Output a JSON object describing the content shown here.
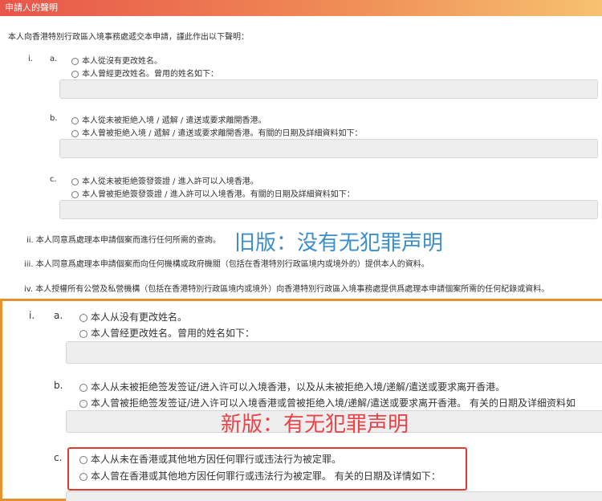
{
  "header": {
    "title": "申請人的聲明"
  },
  "old": {
    "intro": "本人向香港特別行政區入境事務處遞交本申請，謹此作出以下聲明：",
    "item_i": "i.",
    "a": {
      "label": "a.",
      "opt1": "本人從沒有更改姓名。",
      "opt2": "本人曾經更改姓名。曾用的姓名如下："
    },
    "b": {
      "label": "b.",
      "opt1": "本人從未被拒絶入境 / 遞解 / 遣送或要求離開香港。",
      "opt2": "本人曾被拒絶入境 / 遞解 / 遣送或要求離開香港。有關的日期及詳細資料如下："
    },
    "c": {
      "label": "c.",
      "opt1": "本人從未被拒絶簽發簽證 / 進入許可以入境香港。",
      "opt2": "本人曾被拒絶簽發簽證 / 進入許可以入境香港。有關的日期及詳細資料如下："
    },
    "ii": "ii. 本人同意爲處理本申請個案而進行任何所需的查詢。",
    "iii": "iii. 本人同意爲處理本申請個案而向任何機構或政府機關（包括在香港特別行政區境内或境外的）提供本人的資料。",
    "iv": "iv. 本人授權所有公營及私營機構（包括在香港特別行政區境内或境外）向香港特別行政區入境事務處提供爲處理本申請個案所需的任何紀錄或資料。"
  },
  "annotations": {
    "old_label": "旧版：没有无犯罪声明",
    "new_label": "新版：有无犯罪声明"
  },
  "new": {
    "item_i": "i.",
    "a": {
      "label": "a.",
      "opt1": "本人从没有更改姓名。",
      "opt2": "本人曾经更改姓名。曾用的姓名如下："
    },
    "b": {
      "label": "b.",
      "opt1": "本人从未被拒绝签发签证/进入许可以入境香港，以及从未被拒绝入境/递解/遣送或要求离开香港。",
      "opt2": "本人曾被拒绝签发签证/进入许可以入境香港或曾被拒绝入境/递解/遣送或要求离开香港。 有关的日期及详细资料如"
    },
    "c": {
      "label": "c.",
      "opt1": "本人从未在香港或其他地方因任何罪行或违法行为被定罪。",
      "opt2": "本人曾在香港或其他地方因任何罪行或违法行为被定罪。 有关的日期及详情如下："
    }
  },
  "colors": {
    "header_gradient": [
      "#e8554a",
      "#f6c170"
    ],
    "old_annotation": "#3d8ec9",
    "new_annotation": "#e8444a",
    "new_frame": "#e39131",
    "highlight_box": "#e23a33"
  }
}
